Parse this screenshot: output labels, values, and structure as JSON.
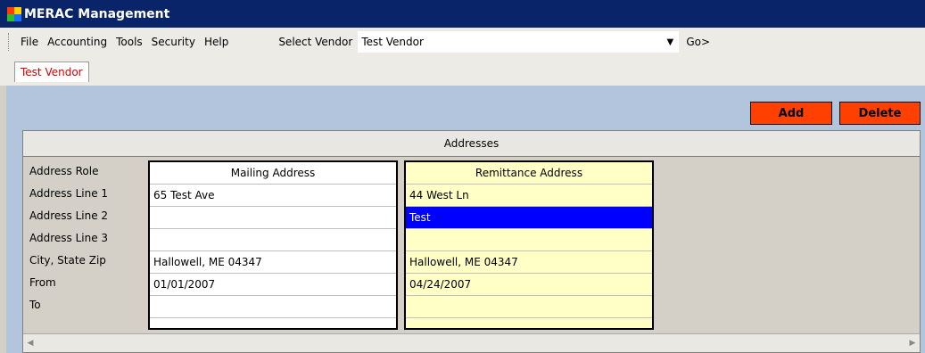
{
  "window": {
    "title": "MERAC Management"
  },
  "menubar": {
    "items": [
      "File",
      "Accounting",
      "Tools",
      "Security",
      "Help"
    ],
    "vendor_label": "Select Vendor",
    "vendor_value": "Test Vendor",
    "go_label": "Go>"
  },
  "tabs": [
    "Test Vendor"
  ],
  "toolbar": {
    "add_label": "Add",
    "delete_label": "Delete"
  },
  "addresses": {
    "header": "Addresses",
    "row_labels": [
      "Address Role",
      "Address Line 1",
      "Address Line 2",
      "Address Line 3",
      "City, State  Zip",
      "From",
      "To"
    ],
    "mailing": [
      "Mailing Address",
      "65 Test Ave",
      "",
      "",
      "Hallowell, ME  04347",
      "01/01/2007",
      ""
    ],
    "remittance": [
      "Remittance Address",
      "44 West Ln",
      "Test",
      "",
      "Hallowell, ME  04347",
      "04/24/2007",
      ""
    ]
  },
  "colors": {
    "titlebar": "#0a246a",
    "button": "#ff4000",
    "tab_text": "#d40000",
    "selection": "#0000ff"
  }
}
